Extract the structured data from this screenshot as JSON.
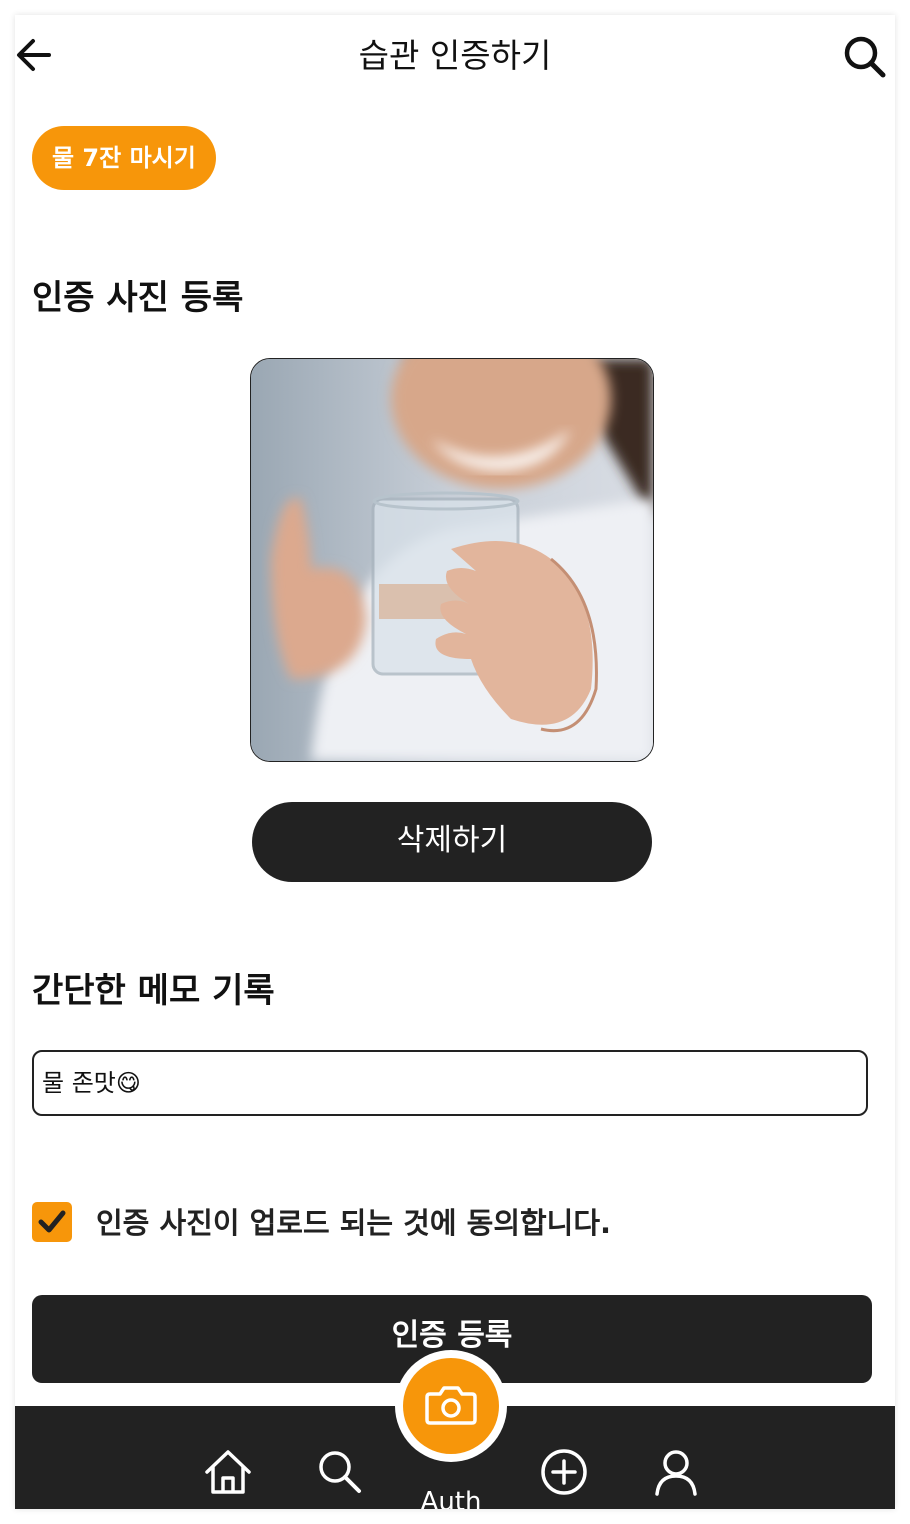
{
  "header": {
    "title": "습관 인증하기"
  },
  "habit_chip": "물 7잔 마시기",
  "photo_section": {
    "title": "인증 사진 등록",
    "delete_label": "삭제하기"
  },
  "memo_section": {
    "title": "간단한 메모 기록",
    "value": "물 존맛😋"
  },
  "agreement": {
    "checked": true,
    "label": "인증 사진이 업로드 되는 것에 동의합니다."
  },
  "submit_label": "인증 등록",
  "bottom_nav": {
    "items": [
      {
        "icon": "home-icon"
      },
      {
        "icon": "search-icon"
      },
      {
        "icon": "camera-icon",
        "label": "Auth"
      },
      {
        "icon": "plus-circle-icon"
      },
      {
        "icon": "user-icon"
      }
    ]
  },
  "colors": {
    "accent": "#f7960a",
    "dark": "#222222"
  }
}
